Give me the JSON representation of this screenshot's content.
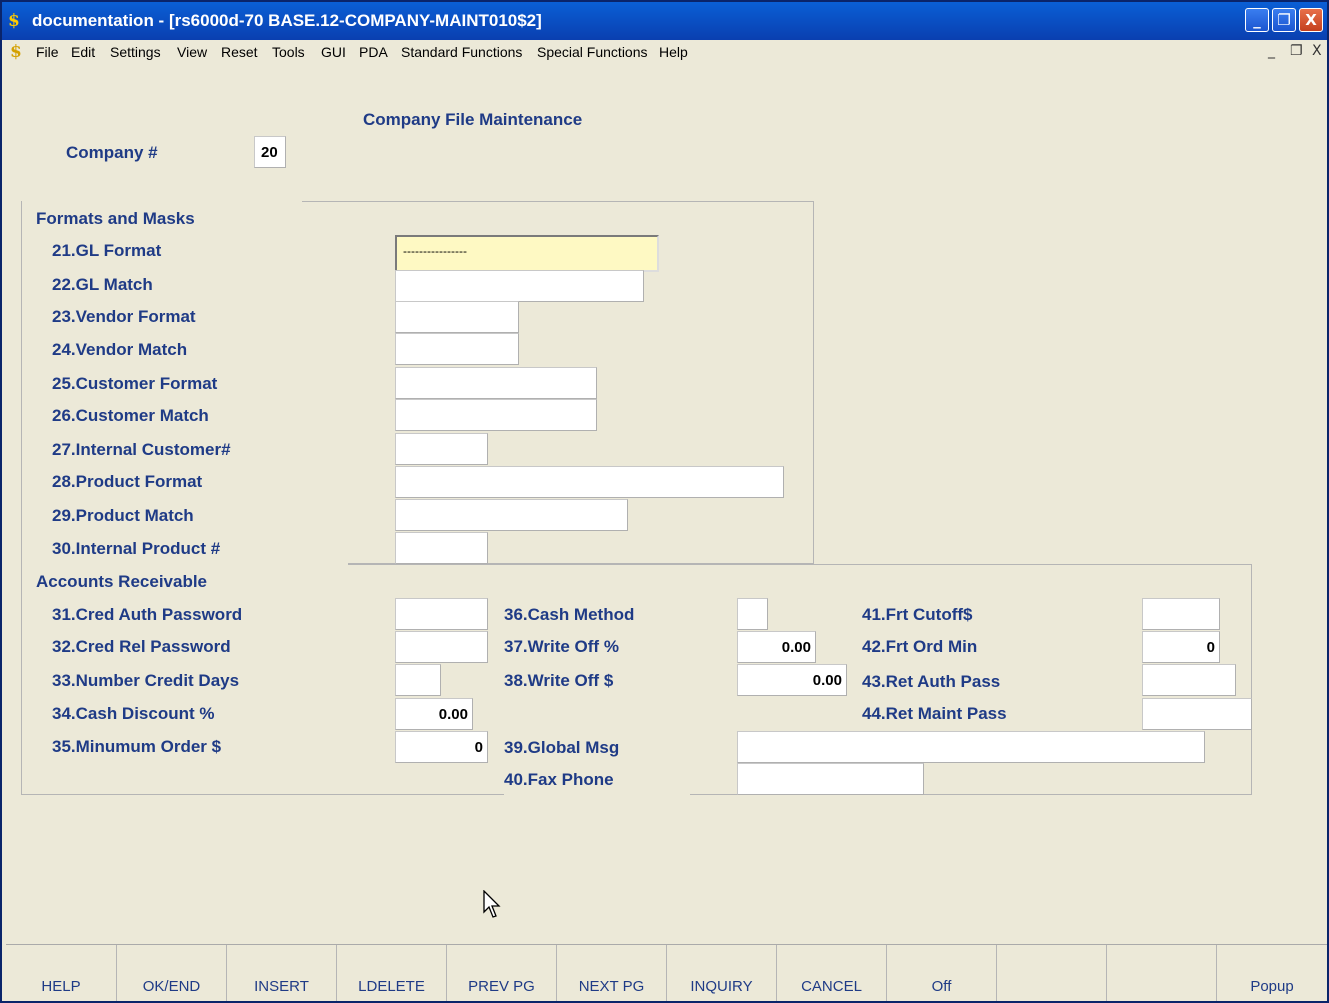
{
  "window": {
    "title": "documentation - [rs6000d-70 BASE.12-COMPANY-MAINT010$2]",
    "controls": [
      "_",
      "❐",
      "X"
    ]
  },
  "menu": {
    "items": [
      "File",
      "Edit",
      "Settings",
      "View",
      "Reset",
      "Tools",
      "GUI",
      "PDA",
      "Standard Functions",
      "Special Functions",
      "Help"
    ],
    "mdi_controls": [
      "_",
      "❐",
      "X"
    ]
  },
  "form": {
    "title": "Company File Maintenance",
    "company_label": "Company #",
    "company_value": "20"
  },
  "formats": {
    "heading": "Formats and Masks",
    "fields": [
      {
        "label": "21.GL Format",
        "value": "----------------"
      },
      {
        "label": "22.GL Match",
        "value": ""
      },
      {
        "label": "23.Vendor Format",
        "value": ""
      },
      {
        "label": "24.Vendor Match",
        "value": ""
      },
      {
        "label": "25.Customer Format",
        "value": ""
      },
      {
        "label": "26.Customer Match",
        "value": ""
      },
      {
        "label": "27.Internal Customer#",
        "value": ""
      },
      {
        "label": "28.Product Format",
        "value": ""
      },
      {
        "label": "29.Product Match",
        "value": ""
      },
      {
        "label": "30.Internal Product #",
        "value": ""
      }
    ]
  },
  "ar": {
    "heading": "Accounts Receivable",
    "col1": [
      {
        "label": "31.Cred Auth Password",
        "value": ""
      },
      {
        "label": "32.Cred Rel Password",
        "value": ""
      },
      {
        "label": "33.Number Credit Days",
        "value": ""
      },
      {
        "label": "34.Cash Discount %",
        "value": "0.00"
      },
      {
        "label": "35.Minumum Order $",
        "value": "0"
      }
    ],
    "col2": [
      {
        "label": "36.Cash Method",
        "value": ""
      },
      {
        "label": "37.Write Off %",
        "value": "0.00"
      },
      {
        "label": "38.Write Off $",
        "value": "0.00"
      },
      {
        "label": "39.Global Msg",
        "value": ""
      },
      {
        "label": "40.Fax Phone",
        "value": ""
      }
    ],
    "col3": [
      {
        "label": "41.Frt Cutoff$",
        "value": ""
      },
      {
        "label": "42.Frt Ord Min",
        "value": "0"
      },
      {
        "label": "43.Ret Auth Pass",
        "value": ""
      },
      {
        "label": "44.Ret Maint Pass",
        "value": ""
      }
    ]
  },
  "footer": {
    "keys": [
      "HELP",
      "OK/END",
      "INSERT",
      "LDELETE",
      "PREV PG",
      "NEXT PG",
      "INQUIRY",
      "CANCEL",
      "Off",
      "",
      "",
      "Popup"
    ]
  }
}
